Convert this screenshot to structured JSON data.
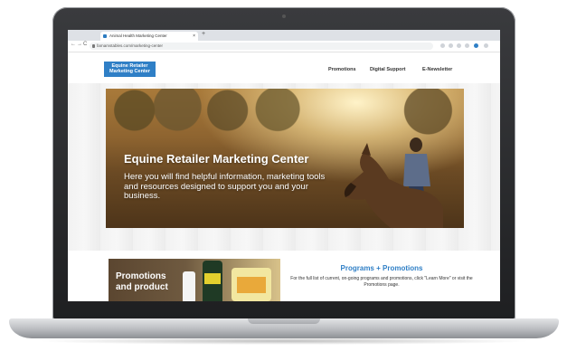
{
  "browser": {
    "tab_title": "Animal Health Marketing Center",
    "tab_close": "×",
    "new_tab": "+",
    "url": "farnamstables.com/marketing-center",
    "nav_back": "←",
    "nav_forward": "→",
    "nav_reload": "C"
  },
  "site": {
    "logo_line1": "Equine Retailer",
    "logo_line2": "Marketing Center",
    "nav": [
      "Promotions",
      "Digital Support",
      "E-Newsletter"
    ]
  },
  "hero": {
    "title": "Equine Retailer Marketing Center",
    "subtitle": "Here you will find helpful information, marketing tools and resources designed to support you and your business."
  },
  "promotions": {
    "image_text_line1": "Promotions",
    "image_text_line2": "and product",
    "heading": "Programs + Promotions",
    "body": "For the full list of current, on-going programs and promotions, click \"Learn More\" or visit the Promotions page."
  },
  "colors": {
    "accent": "#2f7fc6",
    "laptop_frame": "#1e1f21",
    "laptop_base": "#b9bbbf"
  }
}
